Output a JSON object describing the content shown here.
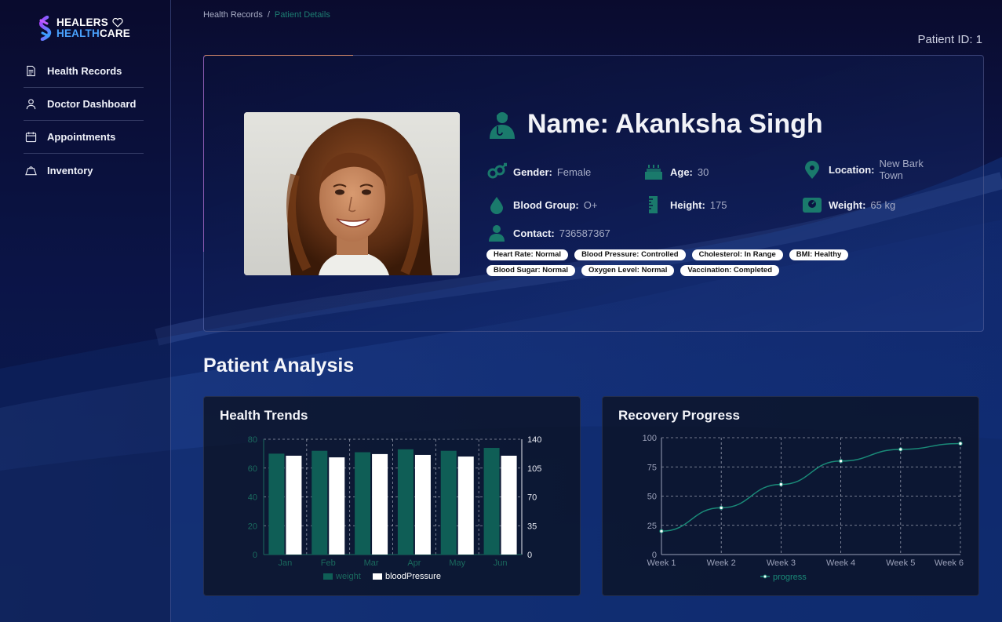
{
  "brand": {
    "line1": "HEALERS",
    "line2_a": "HEALTH",
    "line2_b": "CARE",
    "accent_color": "#4aa3ff"
  },
  "sidebar": {
    "items": [
      {
        "label": "Health Records",
        "icon": "document-icon"
      },
      {
        "label": "Doctor Dashboard",
        "icon": "user-icon"
      },
      {
        "label": "Appointments",
        "icon": "calendar-icon"
      },
      {
        "label": "Inventory",
        "icon": "inventory-icon"
      }
    ]
  },
  "breadcrumb": {
    "root": "Health Records",
    "separator": "/",
    "current": "Patient Details"
  },
  "patient_id": "Patient ID: 1",
  "patient": {
    "name": "Name: Akanksha Singh",
    "gender": {
      "label": "Gender:",
      "value": "Female"
    },
    "age": {
      "label": "Age:",
      "value": "30"
    },
    "location": {
      "label": "Location:",
      "value_line1": "New Bark",
      "value_line2": "Town"
    },
    "blood_group": {
      "label": "Blood Group:",
      "value": "O+"
    },
    "height": {
      "label": "Height:",
      "value": "175"
    },
    "weight": {
      "label": "Weight:",
      "value": "65 kg"
    },
    "contact": {
      "label": "Contact:",
      "value": "736587367"
    },
    "tags_row1": [
      "Heart Rate: Normal",
      "Blood Pressure: Controlled",
      "Cholesterol: In Range",
      "BMI: Healthy"
    ],
    "tags_row2": [
      "Blood Sugar: Normal",
      "Oxygen Level: Normal",
      "Vaccination: Completed"
    ]
  },
  "section_title": "Patient Analysis",
  "colors": {
    "teal": "#0f5e56",
    "teal_icon": "#1a7a6c",
    "white": "#ffffff"
  },
  "chart_data": [
    {
      "type": "bar",
      "title": "Health Trends",
      "categories": [
        "Jan",
        "Feb",
        "Mar",
        "Apr",
        "May",
        "Jun"
      ],
      "series": [
        {
          "name": "weight",
          "axis": "left",
          "color": "#0f5e56",
          "values": [
            70,
            72,
            71,
            73,
            72,
            74
          ]
        },
        {
          "name": "bloodPressure",
          "axis": "right",
          "color": "#ffffff",
          "values": [
            120,
            118,
            122,
            121,
            119,
            120
          ]
        }
      ],
      "y_left": {
        "ylim": [
          0,
          80
        ],
        "ticks": [
          "0",
          "20",
          "40",
          "60",
          "80"
        ]
      },
      "y_right": {
        "ylim": [
          0,
          140
        ],
        "ticks": [
          "0",
          "35",
          "70",
          "105",
          "140"
        ]
      },
      "grid": true,
      "legend": "bottom"
    },
    {
      "type": "line",
      "title": "Recovery Progress",
      "categories": [
        "Week 1",
        "Week 2",
        "Week 3",
        "Week 4",
        "Week 5",
        "Week 6"
      ],
      "series": [
        {
          "name": "progress",
          "color": "#1a8a78",
          "values": [
            20,
            40,
            60,
            80,
            90,
            95
          ]
        }
      ],
      "ylim": [
        0,
        100
      ],
      "yticks": [
        "0",
        "25",
        "50",
        "75",
        "100"
      ],
      "grid": true,
      "legend": "bottom"
    }
  ]
}
